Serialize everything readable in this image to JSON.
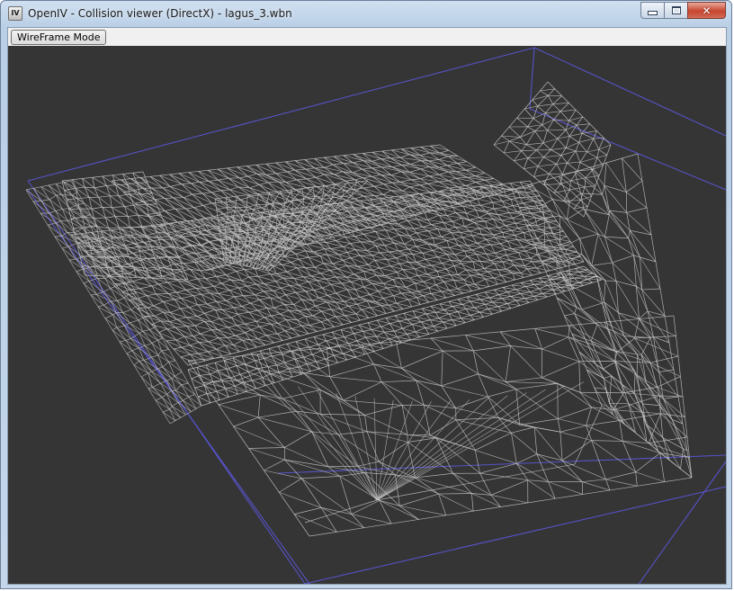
{
  "window": {
    "title": "OpenIV - Collision viewer (DirectX) - lagus_3.wbn",
    "app_icon_label": "IV"
  },
  "toolbar": {
    "wireframe_label": "WireFrame Mode"
  },
  "viewport": {
    "background_color": "#353535",
    "bounds_color": "#5a55d6",
    "mesh_color": "#c4c4c4"
  }
}
